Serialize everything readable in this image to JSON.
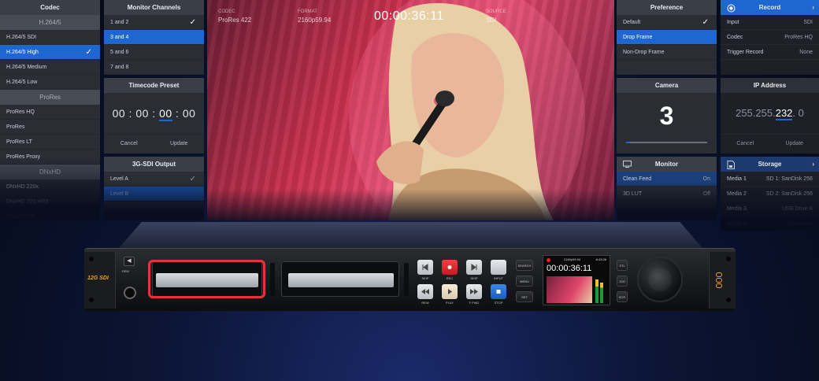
{
  "codec_panel": {
    "title": "Codec",
    "sections": [
      {
        "header": "H.264/5",
        "items": [
          {
            "label": "H.264/5 SDI",
            "selected": false
          },
          {
            "label": "H.264/5 High",
            "selected": true
          },
          {
            "label": "H.264/5 Medium",
            "selected": false
          },
          {
            "label": "H.264/5 Low",
            "selected": false
          }
        ]
      },
      {
        "header": "ProRes",
        "items": [
          {
            "label": "ProRes HQ"
          },
          {
            "label": "ProRes"
          },
          {
            "label": "ProRes LT"
          },
          {
            "label": "ProRes Proxy"
          }
        ]
      },
      {
        "header": "DNxHD",
        "items": [
          {
            "label": "DNxHD 220x"
          },
          {
            "label": "DNxHD 220 HRX"
          },
          {
            "label": "DNxHD 145"
          }
        ]
      }
    ]
  },
  "monitor_channels": {
    "title": "Monitor Channels",
    "items": [
      {
        "label": "1 and 2",
        "checked": true
      },
      {
        "label": "3 and 4",
        "selected": true
      },
      {
        "label": "5 and 6"
      },
      {
        "label": "7 and 8"
      }
    ]
  },
  "timecode_preset": {
    "title": "Timecode Preset",
    "h": "00",
    "m": "00",
    "s": "00",
    "f": "00",
    "cancel": "Cancel",
    "update": "Update"
  },
  "sdi_output": {
    "title": "3G-SDI Output",
    "items": [
      {
        "label": "Level A",
        "checked": true
      },
      {
        "label": "Level B"
      }
    ]
  },
  "video_hud": {
    "codec_label": "CODEC",
    "codec_value": "ProRes 422",
    "format_label": "FORMAT",
    "format_value": "2160p59.94",
    "timecode": "00:00:36:11",
    "source_label": "SOURCE",
    "source_value": "SDI"
  },
  "preference": {
    "title": "Preference",
    "items": [
      {
        "label": "Default",
        "checked": true
      },
      {
        "label": "Drop Frame",
        "selected": true
      },
      {
        "label": "Non-Drop Frame"
      }
    ]
  },
  "camera": {
    "title": "Camera",
    "value": "3",
    "slider_level": 0.05
  },
  "monitor": {
    "title": "Monitor",
    "items": [
      {
        "label": "Clean Feed",
        "value": "On"
      },
      {
        "label": "3D LUT",
        "value": "Off"
      }
    ]
  },
  "record": {
    "title": "Record",
    "rows": [
      {
        "label": "Input",
        "value": "SDI"
      },
      {
        "label": "Codec",
        "value": "ProRes HQ"
      },
      {
        "label": "Trigger Record",
        "value": "None"
      }
    ]
  },
  "ip_address": {
    "title": "IP Address",
    "octets": [
      "255.",
      "255.",
      "232",
      ". 0"
    ],
    "cancel": "Cancel",
    "update": "Update"
  },
  "storage": {
    "title": "Storage",
    "rows": [
      {
        "label": "Media 1",
        "value": "SD 1: SanDisk 256"
      },
      {
        "label": "Media 2",
        "value": "SD 2: SanDisk 256"
      },
      {
        "label": "Media 3",
        "value": "USB Drive A"
      },
      {
        "label": "Media 4",
        "value": "Network A"
      }
    ]
  },
  "device": {
    "brand": "12G SDI",
    "rem_label": "REM",
    "buttons": {
      "skip_back": "SKIP",
      "rec": "REC",
      "skip_fwd": "SKIP",
      "input": "INPUT",
      "rew": "REW",
      "play": "PLAY",
      "ffwd": "F FWD",
      "stop": "STOP",
      "search": "SEARCH",
      "menu": "MENU",
      "set": "SET",
      "stl": "STL",
      "jog": "JOG",
      "scr": "SCR"
    },
    "lcd": {
      "format": "2160p59.94",
      "time": "8:43:26",
      "timecode": "00:00:36:11"
    }
  },
  "colors": {
    "accent": "#1e66d0",
    "record_red": "#e8202a",
    "highlight": "#e8323a"
  }
}
